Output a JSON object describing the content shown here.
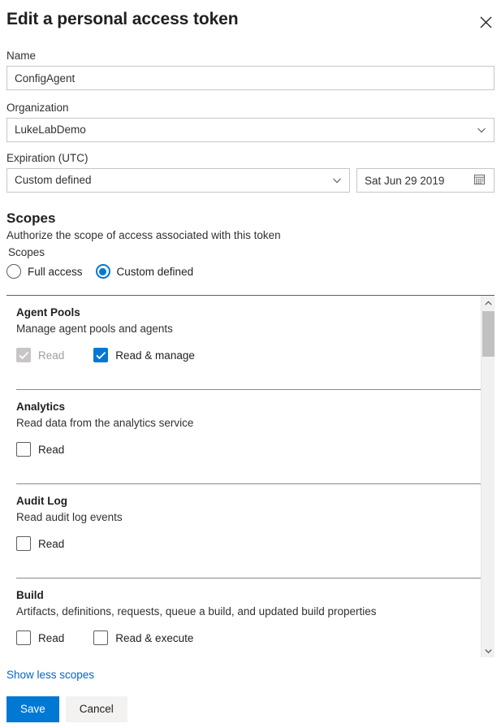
{
  "dialog": {
    "title": "Edit a personal access token",
    "close_label": "Close"
  },
  "form": {
    "name": {
      "label": "Name",
      "value": "ConfigAgent",
      "placeholder": ""
    },
    "organization": {
      "label": "Organization",
      "value": "LukeLabDemo"
    },
    "expiration": {
      "label": "Expiration (UTC)",
      "preset_value": "Custom defined",
      "date_value": "Sat Jun 29 2019"
    }
  },
  "scopes": {
    "heading": "Scopes",
    "description": "Authorize the scope of access associated with this token",
    "group_label": "Scopes",
    "options": [
      {
        "label": "Full access",
        "selected": false
      },
      {
        "label": "Custom defined",
        "selected": true
      }
    ],
    "sections": [
      {
        "name": "Agent Pools",
        "description": "Manage agent pools and agents",
        "checkboxes": [
          {
            "label": "Read",
            "checked": true,
            "disabled": true
          },
          {
            "label": "Read & manage",
            "checked": true,
            "disabled": false
          }
        ]
      },
      {
        "name": "Analytics",
        "description": "Read data from the analytics service",
        "checkboxes": [
          {
            "label": "Read",
            "checked": false,
            "disabled": false
          }
        ]
      },
      {
        "name": "Audit Log",
        "description": "Read audit log events",
        "checkboxes": [
          {
            "label": "Read",
            "checked": false,
            "disabled": false
          }
        ]
      },
      {
        "name": "Build",
        "description": "Artifacts, definitions, requests, queue a build, and updated build properties",
        "checkboxes": [
          {
            "label": "Read",
            "checked": false,
            "disabled": false
          },
          {
            "label": "Read & execute",
            "checked": false,
            "disabled": false
          }
        ]
      }
    ]
  },
  "footer": {
    "show_less_label": "Show less scopes",
    "save_label": "Save",
    "cancel_label": "Cancel"
  },
  "colors": {
    "accent": "#0078d4",
    "link": "#0066cc",
    "disabled": "#c8c6c4",
    "border": "#c8c6c4"
  }
}
